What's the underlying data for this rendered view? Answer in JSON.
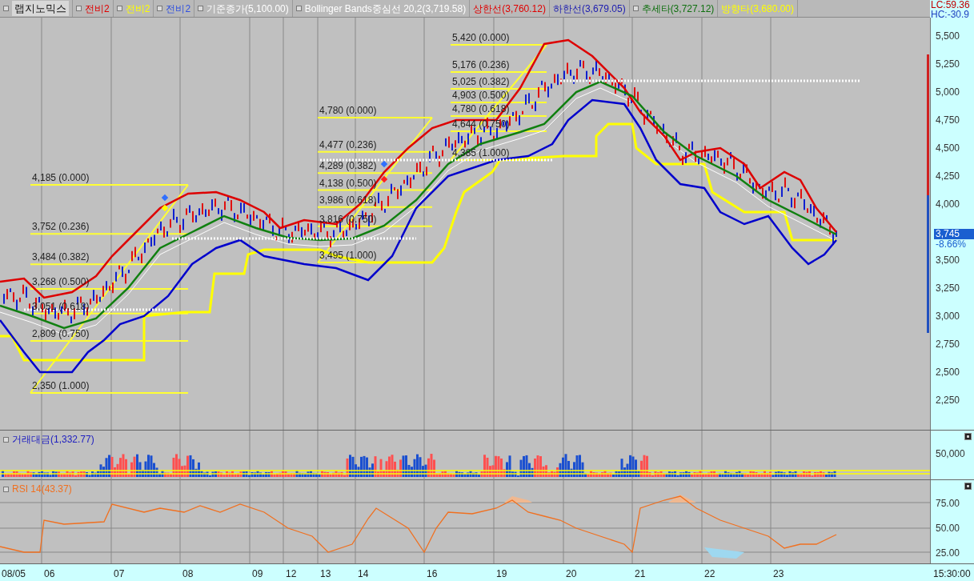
{
  "legend": [
    {
      "kind": "title",
      "label": "랩지노믹스",
      "marker": true
    },
    {
      "kind": "series",
      "label": "전비2",
      "color": "#e00000",
      "marker": true
    },
    {
      "kind": "series",
      "label": "전비2",
      "color": "#ffff00",
      "marker": true
    },
    {
      "kind": "series",
      "label": "전비2",
      "color": "#3050e0",
      "marker": true
    },
    {
      "kind": "series",
      "label": "기준종가(5,100.00)",
      "color": "#ffffff",
      "marker": true
    },
    {
      "kind": "series",
      "label": "Bollinger Bands중심선 20,2(3,719.58)",
      "color": "#ffffff",
      "marker": true
    },
    {
      "kind": "series",
      "label": "상한선(3,760.12)",
      "color": "#e00000",
      "marker": false
    },
    {
      "kind": "series",
      "label": "하한선(3,679.05)",
      "color": "#2020b0",
      "marker": false
    },
    {
      "kind": "series",
      "label": "추세타(3,727.12)",
      "color": "#107010",
      "marker": true
    },
    {
      "kind": "series",
      "label": "방향타(3,680.00)",
      "color": "#ffff00",
      "marker": false
    }
  ],
  "corner": [
    "LC:59.36",
    "HC:-30.9"
  ],
  "fib_sets": [
    {
      "levels": [
        "4,185 (0.000)",
        "3,752 (0.236)",
        "3,484 (0.382)",
        "3,268 (0.500)",
        "3,051 (0.618)",
        "2,809 (0.750)",
        "2,350 (1.000)"
      ]
    },
    {
      "levels": [
        "4,780 (0.000)",
        "4,477 (0.236)",
        "4,289 (0.382)",
        "4,138 (0.500)",
        "3,986 (0.618)",
        "3,816 (0.750)",
        "3,495 (1.000)"
      ]
    },
    {
      "levels": [
        "5,420 (0.000)",
        "5,176 (0.236)",
        "5,025 (0.382)",
        "4,903 (0.500)",
        "4,780 (0.618)",
        "4,644 (0.750)",
        "4,385 (1.000)"
      ]
    }
  ],
  "price_axis": {
    "ticks": [
      "5,500",
      "5,250",
      "5,000",
      "4,750",
      "4,500",
      "4,250",
      "4,000",
      "3,500",
      "3,250",
      "3,000",
      "2,750",
      "2,500",
      "2,250"
    ],
    "current_price": "3,745",
    "change": "-8.66%"
  },
  "volume": {
    "title": "거래대금(1,332.77)",
    "ticks": [
      "50,000"
    ]
  },
  "rsi": {
    "title": "RSI 14(43.37)",
    "ticks": [
      "75.00",
      "50.00",
      "25.00"
    ]
  },
  "dates": [
    "08/05",
    "06",
    "07",
    "08",
    "09",
    "12",
    "13",
    "14",
    "16",
    "19",
    "20",
    "21",
    "22",
    "23"
  ],
  "time": "15:30:00"
}
